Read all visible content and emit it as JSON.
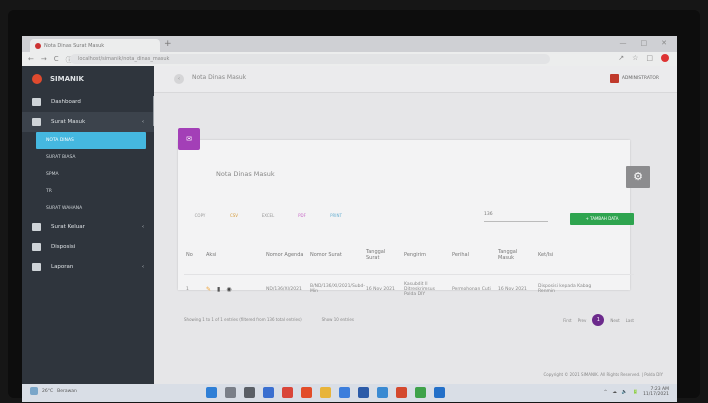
{
  "browser": {
    "tab_title": "Nota Dinas Surat Masuk",
    "new_tab": "+",
    "url": "localhost/simanik/nota_dinas_masuk",
    "nav": [
      "←",
      "→",
      "C",
      "ⓘ"
    ],
    "win_controls": [
      "—",
      "□",
      "✕"
    ],
    "tools": [
      "↗",
      "☆",
      "□"
    ]
  },
  "sidebar": {
    "brand": "SIMANIK",
    "items": [
      {
        "label": "Dashboard"
      },
      {
        "label": "Surat Masuk",
        "caret": "‹"
      },
      {
        "label": "Surat Keluar",
        "caret": "‹"
      },
      {
        "label": "Disposisi"
      },
      {
        "label": "Laporan",
        "caret": "‹"
      }
    ],
    "subitems": [
      "NOTA DINAS",
      "SURAT BIASA",
      "SPMA",
      "TR",
      "SURAT WAHANA"
    ]
  },
  "topbar": {
    "toggle": "‹",
    "breadcrumb": "Nota Dinas Masuk",
    "user": "ADMINISTRATOR"
  },
  "card": {
    "icon": "✉",
    "title": "Nota Dinas Masuk",
    "gear": "⚙",
    "export_buttons": [
      "COPY",
      "CSV",
      "EXCEL",
      "PDF",
      "PRINT"
    ],
    "search_value": "136",
    "add_button": "+ TAMBAH DATA",
    "columns": [
      "No",
      "Aksi",
      "Nomor Agenda",
      "Nomor Surat",
      "Tanggal Surat",
      "Pengirim",
      "Perihal",
      "Tanggal Masuk",
      "Ket/Isi"
    ],
    "rows": [
      {
        "no": "1",
        "agenda": "ND/136/XI/2021",
        "nomor": "B/ND/136/XI/2021/Subd-Min",
        "tanggal_surat": "16 Nov 2021",
        "pengirim": "Kasubdit II Ditreskrimsus Polda DIY",
        "perihal": "Permohonan Cuti",
        "tanggal_masuk": "16 Nov 2021",
        "ket": "Disposisi kepada Kabag Renmin"
      }
    ],
    "footer_info": "Showing 1 to 1 of 1 entries (filtered from 136 total entries)",
    "show_entries": "Show 10 entries",
    "pager": [
      "First",
      "Prev",
      "1",
      "Next",
      "Last"
    ]
  },
  "copyright": "Copyright © 2021 SIMANIK. All Rights Reserved. | Polda DIY",
  "taskbar": {
    "weather_temp": "26°C",
    "weather_desc": "Berawan",
    "time": "7:23 AM",
    "date": "11/17/2021",
    "tray": [
      "^",
      "☁",
      "🔈",
      "🔋"
    ]
  }
}
